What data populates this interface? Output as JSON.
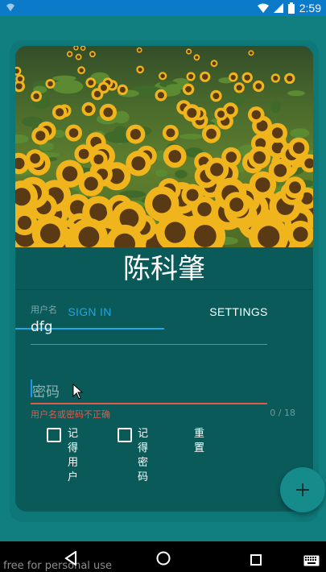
{
  "status_bar": {
    "time": "2:59"
  },
  "hero": {
    "image": "sunflower-field"
  },
  "title": "陈科肇",
  "tabs": [
    {
      "label": "SIGN IN",
      "active": true
    },
    {
      "label": "SETTINGS",
      "active": false
    }
  ],
  "form": {
    "username_label": "用户名",
    "username_value": "dfg",
    "password_placeholder": "密码",
    "error_text": "用户名或密码不正确",
    "counter": "0 / 18"
  },
  "options": {
    "remember_user_label": "记得用户",
    "remember_user_checked": false,
    "remember_password_label": "记得密码",
    "remember_password_checked": false,
    "reset_label": "重置"
  },
  "watermark": "free for personal use",
  "colors": {
    "background": "#117f7f",
    "card": "#0a5a5a",
    "accent": "#1ea7e6",
    "error": "#e05a4a",
    "status_bar": "#0a7ac9"
  }
}
